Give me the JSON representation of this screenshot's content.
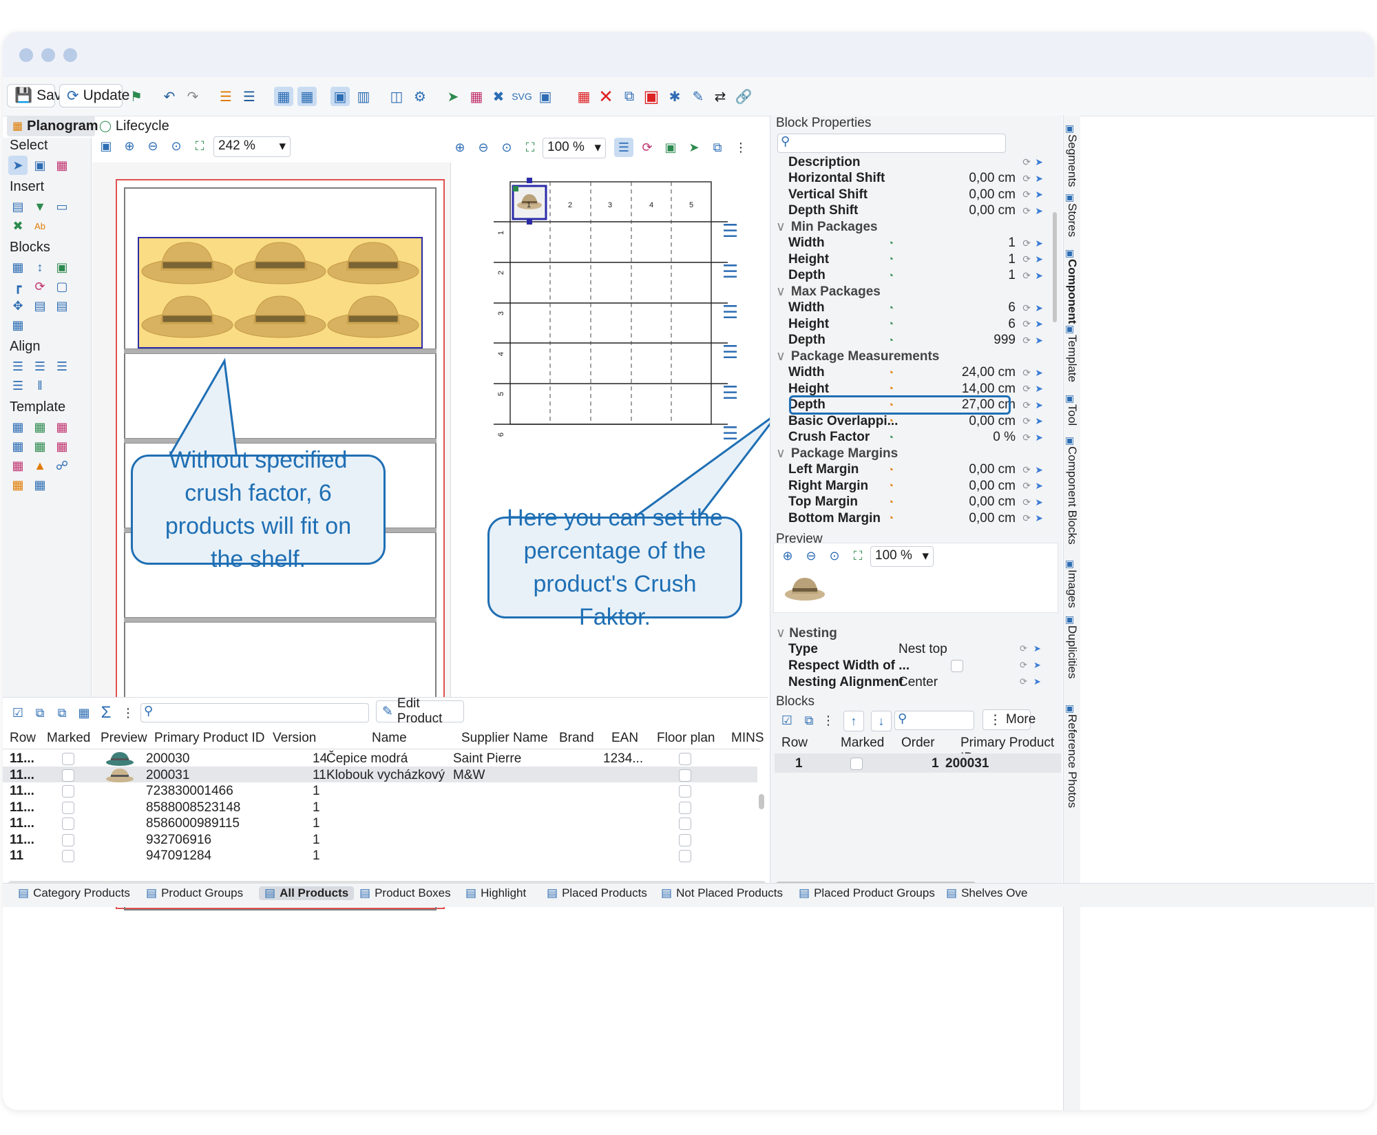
{
  "toolbar": {
    "save_label": "Save",
    "update_label": "Update"
  },
  "tabs": {
    "planogram": "Planogram",
    "lifecycle": "Lifecycle"
  },
  "left_sections": {
    "select": "Select",
    "insert": "Insert",
    "blocks": "Blocks",
    "align": "Align",
    "template": "Template"
  },
  "canvas1": {
    "zoom": "242 %"
  },
  "canvas2": {
    "zoom": "100 %",
    "cols": [
      "1",
      "2",
      "3",
      "4",
      "5"
    ],
    "rows": [
      "1",
      "2",
      "3",
      "4",
      "5",
      "6"
    ]
  },
  "callouts": {
    "left": "Without specified crush factor, 6 products will fit on the shelf.",
    "right": "Here you can set the percentage of the product's Crush Faktor."
  },
  "block_properties": {
    "title": "Block Properties",
    "rows": [
      {
        "name": "Description",
        "value": "",
        "type": "prop"
      },
      {
        "name": "Horizontal Shift",
        "value": "0,00 cm",
        "type": "prop"
      },
      {
        "name": "Vertical Shift",
        "value": "0,00 cm",
        "type": "prop"
      },
      {
        "name": "Depth Shift",
        "value": "0,00 cm",
        "type": "prop"
      },
      {
        "name": "Min Packages",
        "value": "",
        "type": "cat"
      },
      {
        "name": "Width",
        "value": "1",
        "type": "prop",
        "icon": "green"
      },
      {
        "name": "Height",
        "value": "1",
        "type": "prop",
        "icon": "green"
      },
      {
        "name": "Depth",
        "value": "1",
        "type": "prop",
        "icon": "green"
      },
      {
        "name": "Max Packages",
        "value": "",
        "type": "cat"
      },
      {
        "name": "Width",
        "value": "6",
        "type": "prop",
        "icon": "green"
      },
      {
        "name": "Height",
        "value": "6",
        "type": "prop",
        "icon": "green"
      },
      {
        "name": "Depth",
        "value": "999",
        "type": "prop",
        "icon": "green"
      },
      {
        "name": "Package Measurements",
        "value": "",
        "type": "cat"
      },
      {
        "name": "Width",
        "value": "24,00 cm",
        "type": "prop",
        "icon": "orange"
      },
      {
        "name": "Height",
        "value": "14,00 cm",
        "type": "prop",
        "icon": "orange"
      },
      {
        "name": "Depth",
        "value": "27,00 cm",
        "type": "prop",
        "icon": "orange"
      },
      {
        "name": "Basic Overlappi...",
        "value": "0,00 cm",
        "type": "prop",
        "icon": "orange"
      },
      {
        "name": "Crush Factor",
        "value": "0 %",
        "type": "prop",
        "icon": "green",
        "highlight": true
      },
      {
        "name": "Package Margins",
        "value": "",
        "type": "cat"
      },
      {
        "name": "Left Margin",
        "value": "0,00 cm",
        "type": "prop",
        "icon": "orange"
      },
      {
        "name": "Right Margin",
        "value": "0,00 cm",
        "type": "prop",
        "icon": "orange"
      },
      {
        "name": "Top Margin",
        "value": "0,00 cm",
        "type": "prop",
        "icon": "orange"
      },
      {
        "name": "Bottom Margin",
        "value": "0,00 cm",
        "type": "prop",
        "icon": "orange"
      }
    ]
  },
  "preview": {
    "title": "Preview",
    "zoom": "100 %"
  },
  "nesting": {
    "title": "Nesting",
    "rows": [
      {
        "name": "Type",
        "value": "Nest top"
      },
      {
        "name": "Respect Width of ...",
        "value": ""
      },
      {
        "name": "Nesting Alignment",
        "value": "Center"
      }
    ]
  },
  "blocks": {
    "title": "Blocks",
    "more_label": "More",
    "columns": [
      "Row",
      "Marked",
      "Order",
      "Primary Product ID"
    ],
    "rows": [
      {
        "row": "1",
        "order": "1",
        "product_id": "200031"
      }
    ]
  },
  "products": {
    "edit_label": "Edit Product",
    "columns": [
      "Row",
      "Marked",
      "Preview",
      "Primary Product ID",
      "Version",
      "Name",
      "Supplier Name",
      "Brand",
      "EAN",
      "Floor plan",
      "MINS"
    ],
    "rows": [
      {
        "row": "11...",
        "id": "200030",
        "version": "14",
        "name": "Čepice modrá",
        "supplier": "Saint Pierre",
        "ean": "1234..."
      },
      {
        "row": "11...",
        "id": "200031",
        "version": "11",
        "name": "Klobouk vycházkový",
        "supplier": "M&W",
        "ean": ""
      },
      {
        "row": "11...",
        "id": "723830001466",
        "version": "1",
        "name": "",
        "supplier": "",
        "ean": ""
      },
      {
        "row": "11...",
        "id": "8588008523148",
        "version": "1",
        "name": "",
        "supplier": "",
        "ean": ""
      },
      {
        "row": "11...",
        "id": "8586000989115",
        "version": "1",
        "name": "",
        "supplier": "",
        "ean": ""
      },
      {
        "row": "11...",
        "id": "932706916",
        "version": "1",
        "name": "",
        "supplier": "",
        "ean": ""
      },
      {
        "row": "11",
        "id": "947091284",
        "version": "1",
        "name": "",
        "supplier": "",
        "ean": ""
      }
    ]
  },
  "vertical_tabs": [
    "Segments",
    "Stores",
    "Component",
    "Template",
    "Tool",
    "Component Blocks",
    "Images",
    "Duplicities",
    "Reference Photos"
  ],
  "status_tabs": [
    "Category Products",
    "Product Groups",
    "All Products",
    "Product Boxes",
    "Highlight",
    "Placed Products",
    "Not Placed Products",
    "Placed Product Groups",
    "Shelves Ove"
  ]
}
